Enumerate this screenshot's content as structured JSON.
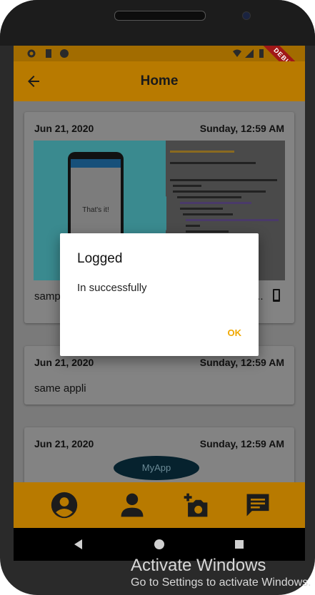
{
  "appbar": {
    "title": "Home"
  },
  "statusbar": {
    "debug_banner": "DEBUG"
  },
  "cards": [
    {
      "date": "Jun 21, 2020",
      "time": "Sunday, 12:59 AM",
      "text": "samp",
      "image_caption": "That's it!",
      "trailing": "..."
    },
    {
      "date": "Jun 21, 2020",
      "time": "Sunday, 12:59 AM",
      "text": "same appli"
    },
    {
      "date": "Jun 21, 2020",
      "time": "Sunday, 12:59 AM",
      "pill": "MyApp"
    }
  ],
  "dialog": {
    "title": "Logged",
    "body": "In successfully",
    "ok_label": "OK"
  },
  "bottom_nav": [
    "account-circle-icon",
    "person-icon",
    "add-photo-icon",
    "chat-icon"
  ],
  "watermark": {
    "line1": "Activate Windows",
    "line2": "Go to Settings to activate Windows."
  },
  "colors": {
    "accent": "#f0a800",
    "appbar_dimmed": "#b87a00",
    "dialog_bg": "#ffffff"
  }
}
